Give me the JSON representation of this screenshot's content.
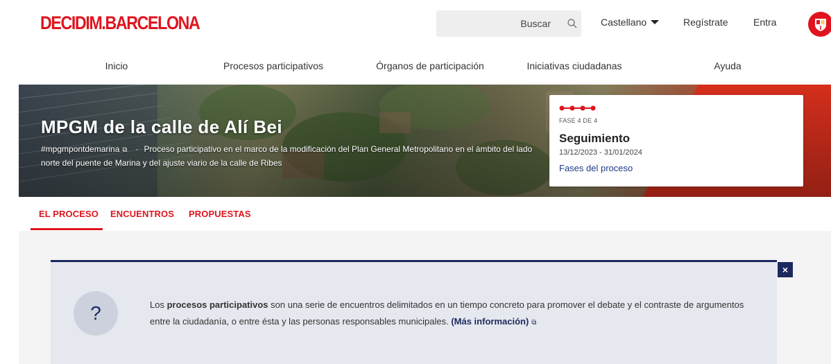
{
  "header": {
    "logo_text": "DECIDIM.BARCELONA",
    "search_placeholder": "Buscar",
    "language": "Castellano",
    "register": "Regístrate",
    "login": "Entra"
  },
  "nav": {
    "items": [
      {
        "label": "Inicio"
      },
      {
        "label": "Procesos participativos"
      },
      {
        "label": "Órganos de participación"
      },
      {
        "label": "Iniciativas ciudadanas"
      },
      {
        "label": "Ayuda"
      }
    ]
  },
  "hero": {
    "title": "MPGM de la calle de Alí Bei",
    "hashtag": "#mpgmpontdemarina",
    "description": "Proceso participativo en el marco de la modificación del Plan General Metropolitano en el ámbito del lado norte del puente de Marina y del ajuste viario de la calle de Ribes"
  },
  "phase": {
    "count_label": "FASE 4 DE 4",
    "title": "Seguimiento",
    "dates": "13/12/2023 - 31/01/2024",
    "link": "Fases del proceso",
    "current": 4,
    "total": 4
  },
  "tabs": [
    {
      "label": "EL PROCESO",
      "active": true
    },
    {
      "label": "ENCUENTROS",
      "active": false
    },
    {
      "label": "PROPUESTAS",
      "active": false
    }
  ],
  "callout": {
    "icon": "?",
    "close": "×",
    "text_before": "Los ",
    "text_bold": "procesos participativos",
    "text_after": " son una serie de encuentros delimitados en un tiempo concreto para promover el debate y el contraste de argumentos entre la ciudadanía, o entre ésta y las personas responsables municipales. ",
    "more_link": "(Más información)"
  },
  "colors": {
    "brand_red": "#e0141e",
    "navy": "#1b2a5e",
    "link_blue": "#1e3a8a"
  }
}
